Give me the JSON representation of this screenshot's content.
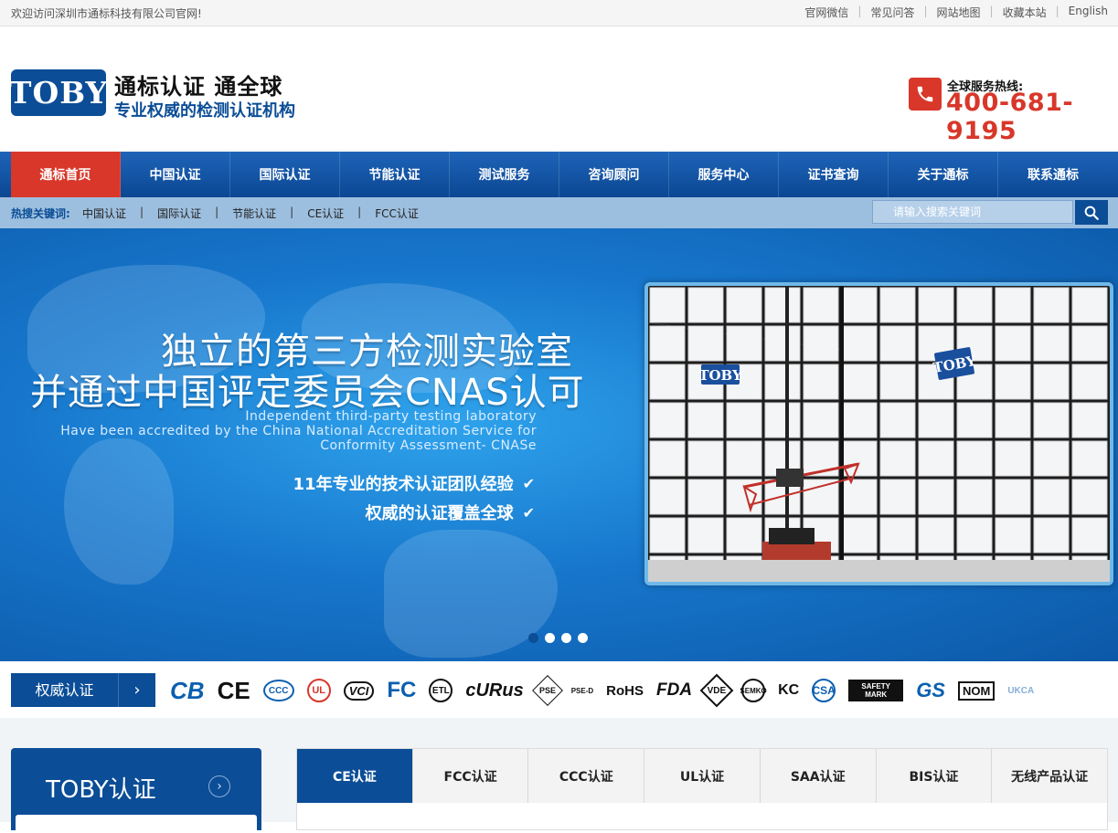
{
  "topbar": {
    "welcome": "欢迎访问深圳市通标科技有限公司官网!",
    "links": [
      "官网微信",
      "常见问答",
      "网站地图",
      "收藏本站",
      "English"
    ]
  },
  "header": {
    "logo": "TOBY",
    "slogan_main": "通标认证  通全球",
    "slogan_sub": "专业权威的检测认证机构",
    "hotline_label": "全球服务热线:",
    "hotline_number": "400-681-9195"
  },
  "nav": {
    "items": [
      "通标首页",
      "中国认证",
      "国际认证",
      "节能认证",
      "测试服务",
      "咨询顾问",
      "服务中心",
      "证书查询",
      "关于通标",
      "联系通标"
    ],
    "active_index": 0
  },
  "hot_search": {
    "label": "热搜关键词:",
    "keywords": [
      "中国认证",
      "国际认证",
      "节能认证",
      "CE认证",
      "FCC认证"
    ],
    "placeholder": "请输入搜索关键词"
  },
  "banner": {
    "headline1": "独立的第三方检测实验室",
    "headline2": "并通过中国评定委员会CNAS认可",
    "english_line1": "Independent third-party testing laboratory",
    "english_line2": "Have been accredited by the China National Accreditation Service for",
    "english_line3": "Conformity Assessment- CNASe",
    "feature1": "11年专业的技术认证团队经验",
    "feature2": "权威的认证覆盖全球",
    "photo_logo": "TOBY",
    "slides_total": 4,
    "active_slide": 1
  },
  "certs": {
    "button_label": "权威认证",
    "marks": [
      "CB",
      "CE",
      "CCC",
      "UL",
      "VCI",
      "FC",
      "ETL",
      "cURus",
      "PSE",
      "PSE-D",
      "RoHS",
      "FDA",
      "VDE",
      "SEMKO",
      "KC",
      "CSA",
      "SAFETY MARK",
      "GS",
      "NOM",
      "UKCA"
    ]
  },
  "side": {
    "title": "TOBY认证"
  },
  "tabs": {
    "items": [
      "CE认证",
      "FCC认证",
      "CCC认证",
      "UL认证",
      "SAA认证",
      "BIS认证",
      "无线产品认证"
    ],
    "active_index": 0
  },
  "colors": {
    "brand_blue": "#0b4d96",
    "accent_red": "#d8372a"
  }
}
